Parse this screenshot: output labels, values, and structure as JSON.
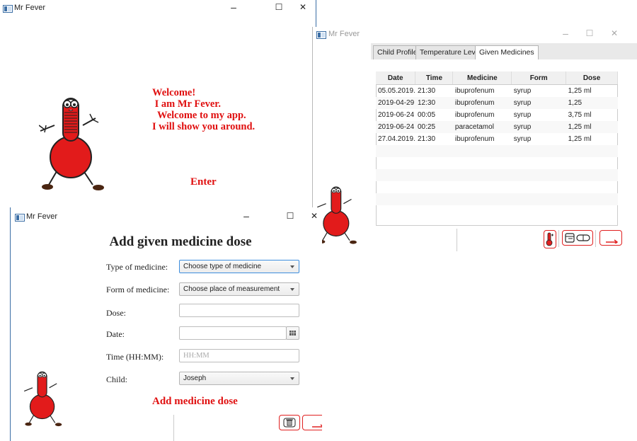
{
  "app": {
    "title": "Mr Fever"
  },
  "welcome_window": {
    "message": "Welcome!\n I am Mr Fever.\n  Welcome to my app.\nI will show you around.",
    "enter_label": "Enter"
  },
  "medicines_window": {
    "tabs": [
      "Child Profile",
      "Temperature Levels",
      "Given Medicines"
    ],
    "active_tab": "Given Medicines",
    "columns": [
      "Date",
      "Time",
      "Medicine",
      "Form",
      "Dose"
    ],
    "rows": [
      [
        "05.05.2019.",
        "21:30",
        "ibuprofenum",
        "syrup",
        "1,25 ml"
      ],
      [
        "2019-04-29",
        "12:30",
        "ibuprofenum",
        "syrup",
        "1,25"
      ],
      [
        "2019-06-24",
        "00:05",
        "ibuprofenum",
        "syrup",
        "3,75 ml"
      ],
      [
        "2019-06-24",
        "00:25",
        "paracetamol",
        "syrup",
        "1,25 ml"
      ],
      [
        "27.04.2019.",
        "21:30",
        "ibuprofenum",
        "syrup",
        "1,25 ml"
      ]
    ],
    "buttons": [
      "thermometer-icon",
      "medicine-icon",
      "back-arrow-icon"
    ]
  },
  "dose_window": {
    "heading": "Add given medicine dose",
    "labels": {
      "type": "Type of medicine:",
      "form": "Form of medicine:",
      "dose": "Dose:",
      "date": "Date:",
      "time": "Time (HH:MM):",
      "child": "Child:"
    },
    "fields": {
      "type_value": "Choose type of medicine",
      "form_value": "Choose place of measurement",
      "dose_value": "",
      "date_value": "",
      "time_placeholder": "HH:MM",
      "child_value": "Joseph"
    },
    "submit_label": "Add medicine dose"
  },
  "colors": {
    "accent_red": "#e01010",
    "focus_blue": "#3d8ede",
    "window_border": "#3b6ea5"
  }
}
